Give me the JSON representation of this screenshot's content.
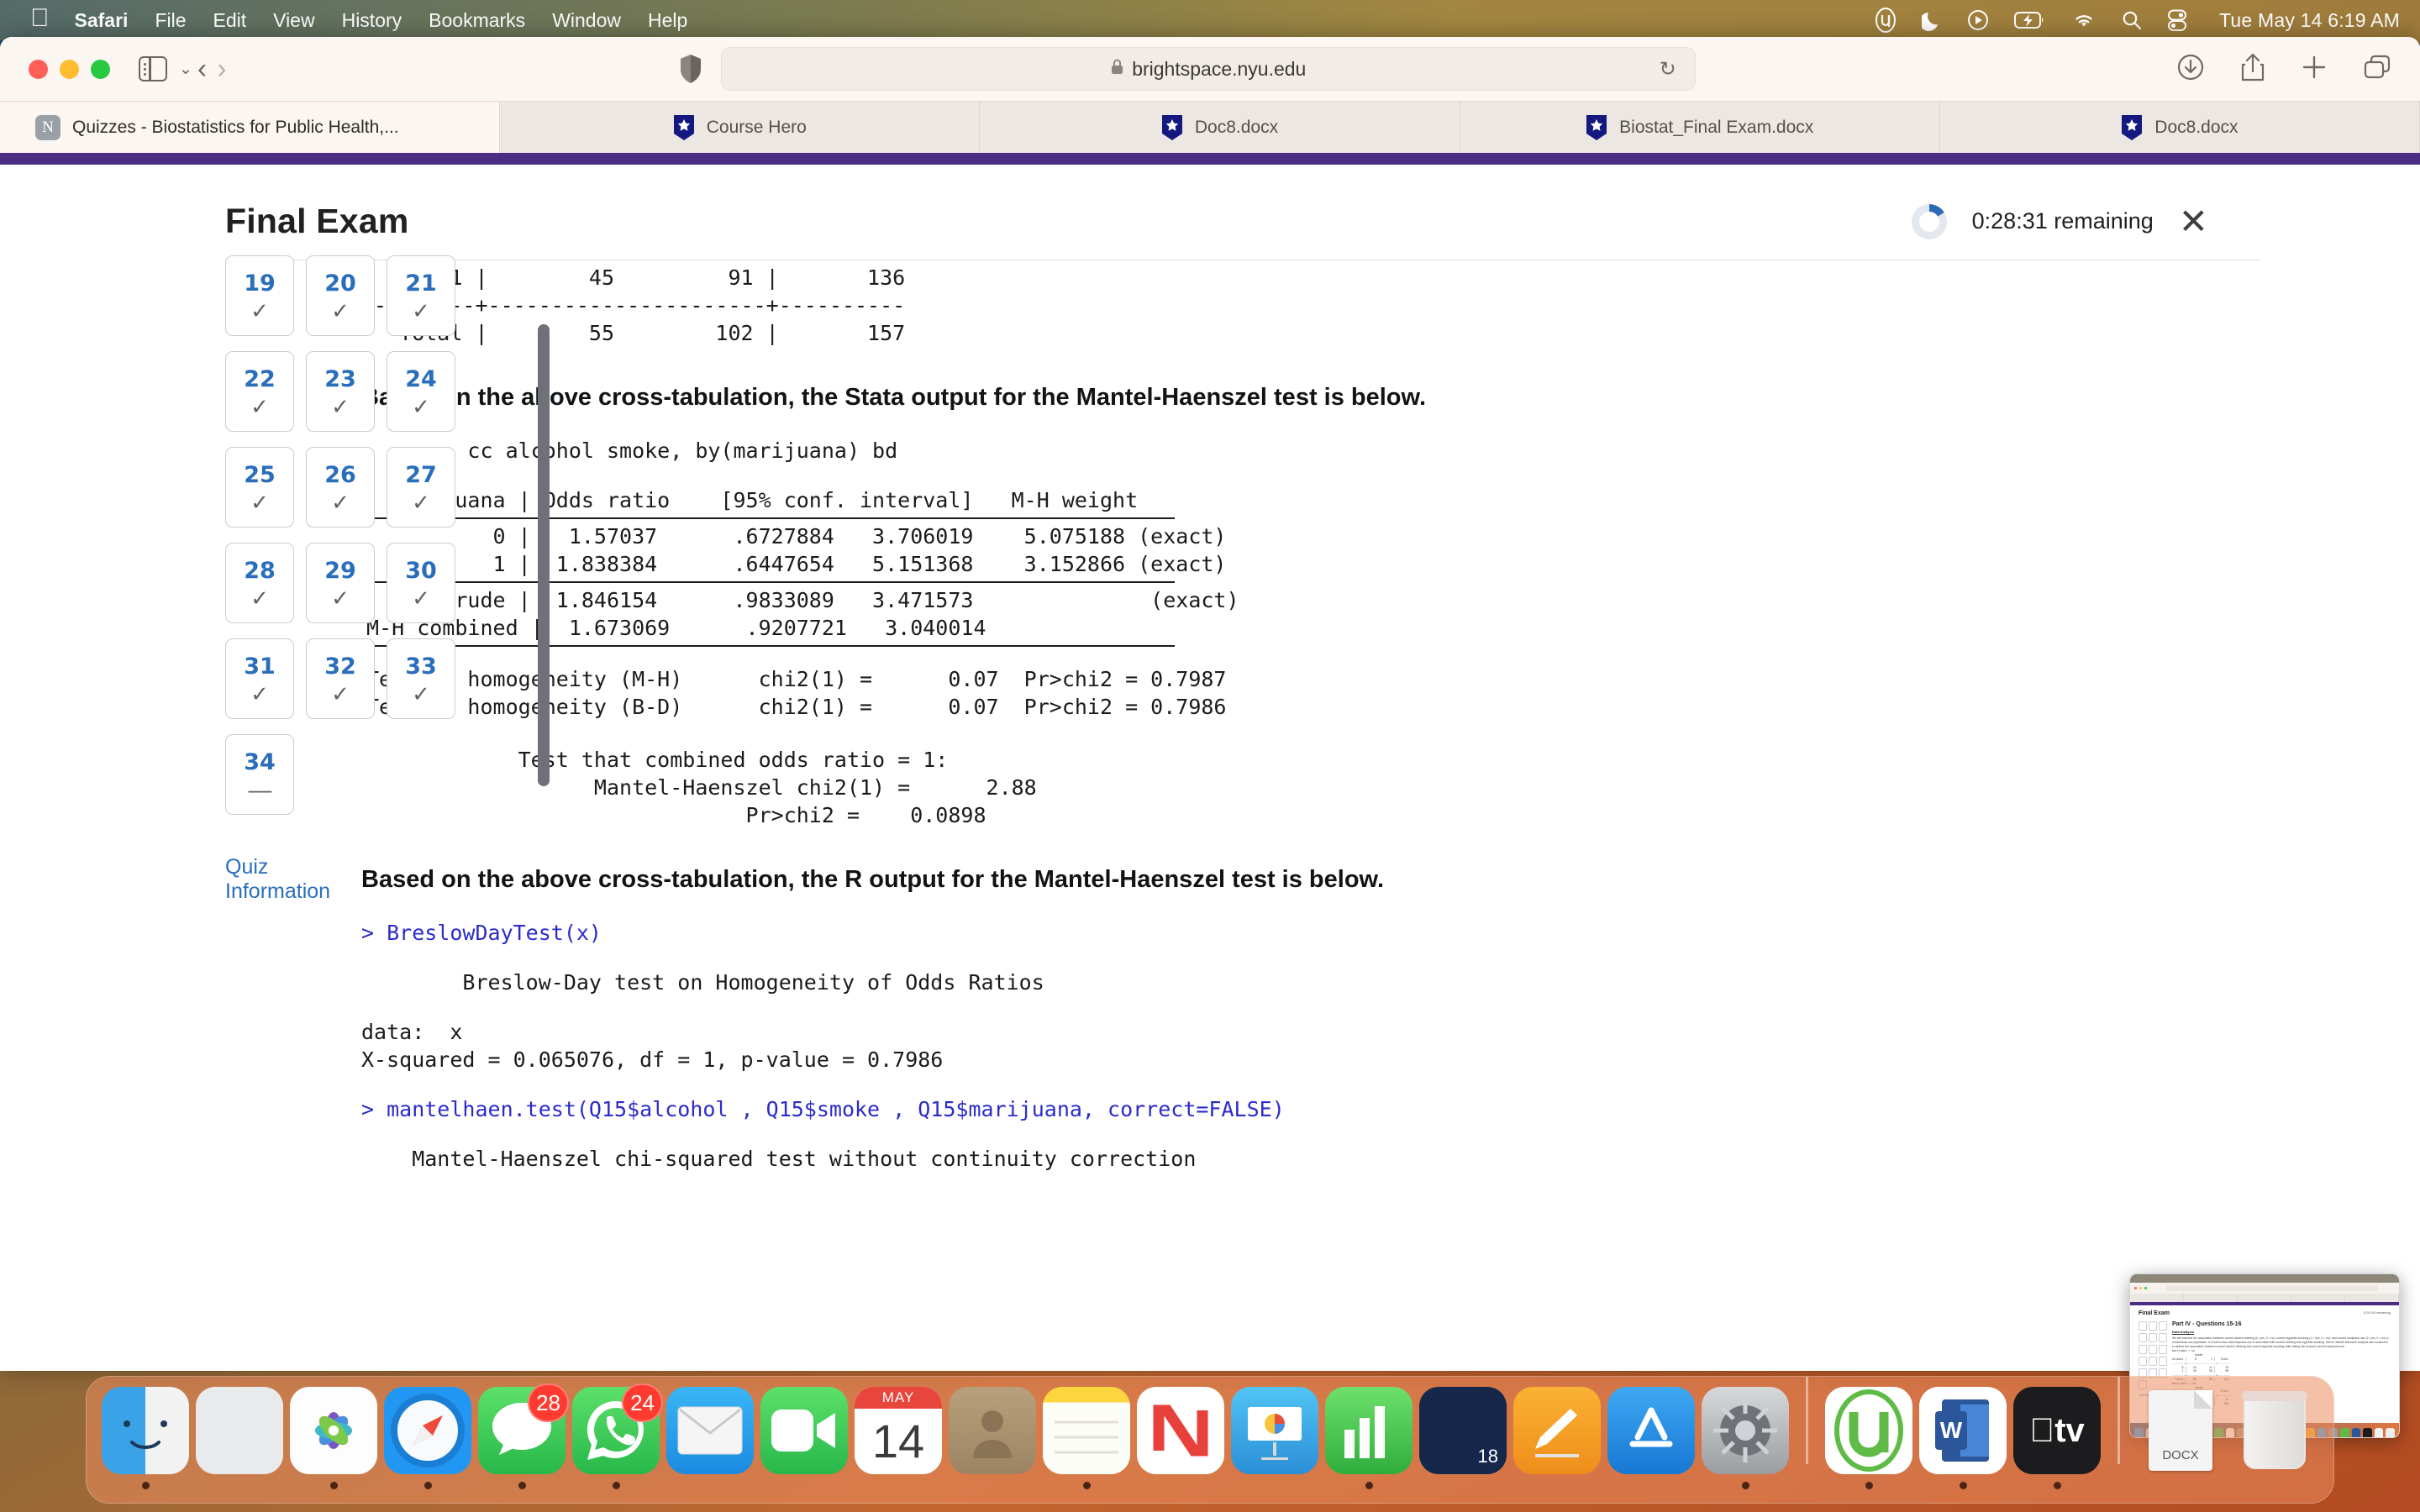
{
  "menubar": {
    "apple": "apple-logo",
    "items": [
      "Safari",
      "File",
      "Edit",
      "View",
      "History",
      "Bookmarks",
      "Window",
      "Help"
    ],
    "clock": "Tue May 14  6:19 AM",
    "status_icons": [
      "utorrent-icon",
      "do-not-disturb-moon-icon",
      "now-playing-icon",
      "battery-charging-icon",
      "wifi-icon",
      "spotlight-search-icon",
      "control-center-icon"
    ]
  },
  "browser": {
    "url": "brightspace.nyu.edu",
    "lock": "A",
    "reload": "↻",
    "tabs": [
      {
        "label": "Quizzes - Biostatistics for Public Health,...",
        "favicon": "nyu-n-icon",
        "active": true
      },
      {
        "label": "Course Hero",
        "favicon": "course-hero-icon",
        "active": false
      },
      {
        "label": "Doc8.docx",
        "favicon": "course-hero-icon",
        "active": false
      },
      {
        "label": "Biostat_Final Exam.docx",
        "favicon": "course-hero-icon",
        "active": false
      },
      {
        "label": "Doc8.docx",
        "favicon": "course-hero-icon",
        "active": false
      }
    ],
    "toolbar_right": [
      "downloads-icon",
      "share-icon",
      "new-tab-icon",
      "tab-overview-icon"
    ]
  },
  "exam": {
    "title": "Final Exam",
    "timer": "0:28:31 remaining",
    "close": "✕",
    "quiz_information_link": "Quiz Information",
    "questions": [
      {
        "num": "19",
        "status": "✓"
      },
      {
        "num": "20",
        "status": "✓"
      },
      {
        "num": "21",
        "status": "✓"
      },
      {
        "num": "22",
        "status": "✓"
      },
      {
        "num": "23",
        "status": "✓"
      },
      {
        "num": "24",
        "status": "✓"
      },
      {
        "num": "25",
        "status": "✓"
      },
      {
        "num": "26",
        "status": "✓"
      },
      {
        "num": "27",
        "status": "✓"
      },
      {
        "num": "28",
        "status": "✓"
      },
      {
        "num": "29",
        "status": "✓"
      },
      {
        "num": "30",
        "status": "✓"
      },
      {
        "num": "31",
        "status": "✓"
      },
      {
        "num": "32",
        "status": "✓"
      },
      {
        "num": "33",
        "status": "✓"
      },
      {
        "num": "34",
        "status": "––"
      }
    ]
  },
  "content": {
    "crosstab_rows": [
      "       1 |        45         91 |       136",
      "---------+----------------------+----------",
      "   Total |        55        102 |       157"
    ],
    "stata_heading": "Based on the above cross-tabulation, the Stata output for the Mantel-Haenszel test is below.",
    "stata_command": ".       cc alcohol smoke, by(marijuana) bd",
    "stata_table_header": "  marijuana | Odds ratio    [95% conf. interval]   M-H weight",
    "stata_rows": [
      "          0 |   1.57037      .6727884   3.706019    5.075188 (exact)",
      "          1 |  1.838384      .6447654   5.151368    3.152866 (exact)"
    ],
    "stata_summary_rows": [
      "      Crude |  1.846154      .9833089   3.471573              (exact)",
      "M-H combined |  1.673069      .9207721   3.040014"
    ],
    "stata_tests": [
      "Test of homogeneity (M-H)      chi2(1) =      0.07  Pr>chi2 = 0.7987",
      "Test of homogeneity (B-D)      chi2(1) =      0.07  Pr>chi2 = 0.7986"
    ],
    "stata_combined": [
      "            Test that combined odds ratio = 1:",
      "                  Mantel-Haenszel chi2(1) =      2.88",
      "                              Pr>chi2 =    0.0898"
    ],
    "r_heading": "Based on the above cross-tabulation, the R output for the Mantel-Haenszel test is below.",
    "r_cmd1": "> BreslowDayTest(x)",
    "r_out1": "        Breslow-Day test on Homogeneity of Odds Ratios",
    "r_out2": "data:  x",
    "r_out3": "X-squared = 0.065076, df = 1, p-value = 0.7986",
    "r_cmd2": "> mantelhaen.test(Q15$alcohol , Q15$smoke , Q15$marijuana, correct=FALSE)",
    "r_out4": "    Mantel-Haenszel chi-squared test without continuity correction"
  },
  "preview": {
    "title": "Final Exam",
    "timer": "0:29:16 remaining",
    "heading": "Part IV - Questions 15-16",
    "subheading": "Data Analysis",
    "paragraph": "We will examine the association between current alcohol drinking (1= yes, 0 = no), current cigarette smoking (1 = yes, 0 = no), and current marijuana use (1= yes, 0 = no) in a substance use population. It is well known that marijuana use is associated with alcohol drinking and cigarette smoking. Hence, Mantel-Haenszel analysis was conducted to assess the association between current alcohol drinking and current cigarette smoking while taking into account current marijuana use.",
    "table1": "marijuana = no\n              smoke\nalcohol |     0         1 |   Total\n--------+------------------+--------\n      0 |    24        11 |      35\n      1 |    45        55 |      98\n--------+------------------+--------\n  Total |    65        68 |     133",
    "table2": "marijuana = yes\n              smoke\nalcohol |     0         1 |   Total\n--------+------------------+--------\n      0 |    10        11 |      21\n      1 |    45        91 |     136",
    "quiz_info": "Quiz Information"
  },
  "dock": {
    "items": [
      {
        "name": "finder",
        "label": "Finder",
        "running": true
      },
      {
        "name": "launchpad",
        "label": "Launchpad",
        "running": false
      },
      {
        "name": "photos",
        "label": "Photos",
        "running": true
      },
      {
        "name": "safari",
        "label": "Safari",
        "running": true
      },
      {
        "name": "messages",
        "label": "Messages",
        "badge": "28",
        "running": true
      },
      {
        "name": "whatsapp",
        "label": "WhatsApp",
        "badge": "24",
        "running": true
      },
      {
        "name": "mail",
        "label": "Mail",
        "running": false
      },
      {
        "name": "facetime",
        "label": "FaceTime",
        "running": false
      },
      {
        "name": "calendar",
        "label": "Calendar",
        "month": "MAY",
        "day": "14",
        "running": false
      },
      {
        "name": "contacts",
        "label": "Contacts",
        "running": false
      },
      {
        "name": "notes",
        "label": "Notes",
        "running": true
      },
      {
        "name": "news",
        "label": "News",
        "running": false
      },
      {
        "name": "keynote",
        "label": "Keynote",
        "running": false
      },
      {
        "name": "numbers",
        "label": "Numbers",
        "running": true
      },
      {
        "name": "app-grid",
        "label": "18",
        "running": false
      },
      {
        "name": "pages",
        "label": "Pages",
        "running": false
      },
      {
        "name": "app-store",
        "label": "App Store",
        "running": false
      },
      {
        "name": "system-preferences",
        "label": "System Preferences",
        "running": true
      },
      {
        "name": "utorrent",
        "label": "uTorrent",
        "running": true
      },
      {
        "name": "word",
        "label": "Microsoft Word",
        "running": true
      },
      {
        "name": "apple-tv",
        "label": "tv",
        "running": true
      },
      {
        "name": "docx-file",
        "label": "DOCX",
        "running": false
      },
      {
        "name": "trash",
        "label": "Trash",
        "running": false
      }
    ]
  },
  "colors": {
    "accent_blue": "#2a6ebb",
    "nyu_purple": "#4b2e83",
    "badge_red": "#ff3b30",
    "code_blue": "#2b2bcc"
  }
}
